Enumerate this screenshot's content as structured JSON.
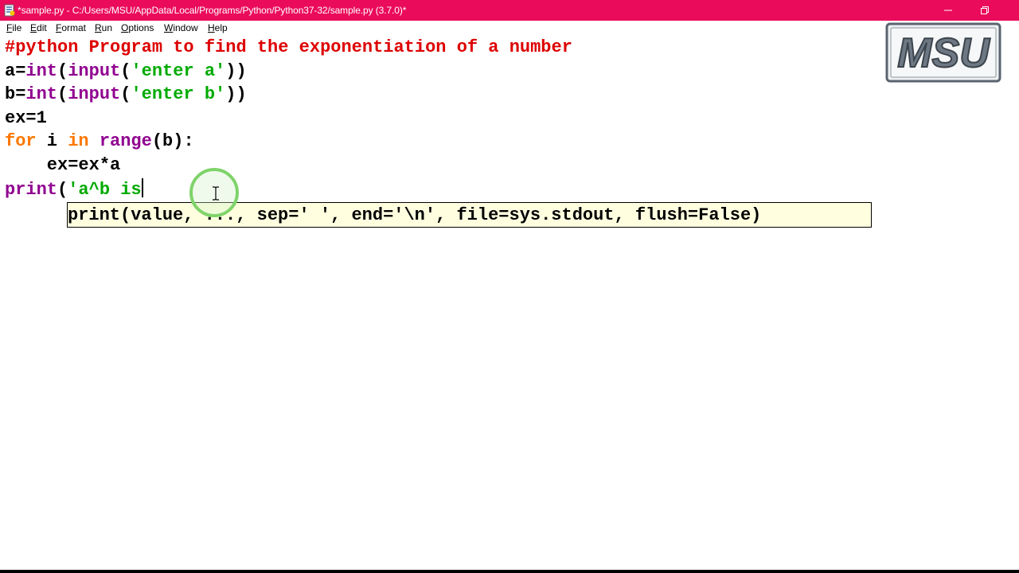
{
  "window": {
    "title": "*sample.py - C:/Users/MSU/AppData/Local/Programs/Python/Python37-32/sample.py (3.7.0)*",
    "title_bar_color": "#ea0b5a"
  },
  "menu": {
    "items": [
      {
        "label": "File"
      },
      {
        "label": "Edit"
      },
      {
        "label": "Format"
      },
      {
        "label": "Run"
      },
      {
        "label": "Options"
      },
      {
        "label": "Window"
      },
      {
        "label": "Help"
      }
    ]
  },
  "editor": {
    "lines": [
      {
        "comment": "#python Program to find the exponentiation of a number"
      },
      {
        "t1": "a=",
        "b1": "int",
        "t2": "(",
        "b2": "input",
        "t3": "(",
        "s1": "'enter a'",
        "t4": "))"
      },
      {
        "t1": "b=",
        "b1": "int",
        "t2": "(",
        "b2": "input",
        "t3": "(",
        "s1": "'enter b'",
        "t4": "))"
      },
      {
        "t1": "ex=1"
      },
      {
        "k1": "for",
        "t1": " i ",
        "k2": "in",
        "t2": " ",
        "b1": "range",
        "t3": "(b):"
      },
      {
        "t1": "    ex=ex*a"
      },
      {
        "b1": "print",
        "t1": "(",
        "s1": "'a^b is"
      }
    ],
    "calltip": "print(value, ..., sep=' ', end='\\n', file=sys.stdout, flush=False)"
  },
  "logo": {
    "text": "MSU"
  },
  "icons": {
    "app": "python-idle-icon",
    "minimize": "minimize-icon",
    "maximize": "restore-icon",
    "cursor": "text-cursor-icon",
    "click": "click-highlight"
  },
  "colors": {
    "comment": "#dd0000",
    "keyword": "#ff7700",
    "builtin": "#900090",
    "string": "#00aa00",
    "calltip_bg": "#ffffe0"
  }
}
